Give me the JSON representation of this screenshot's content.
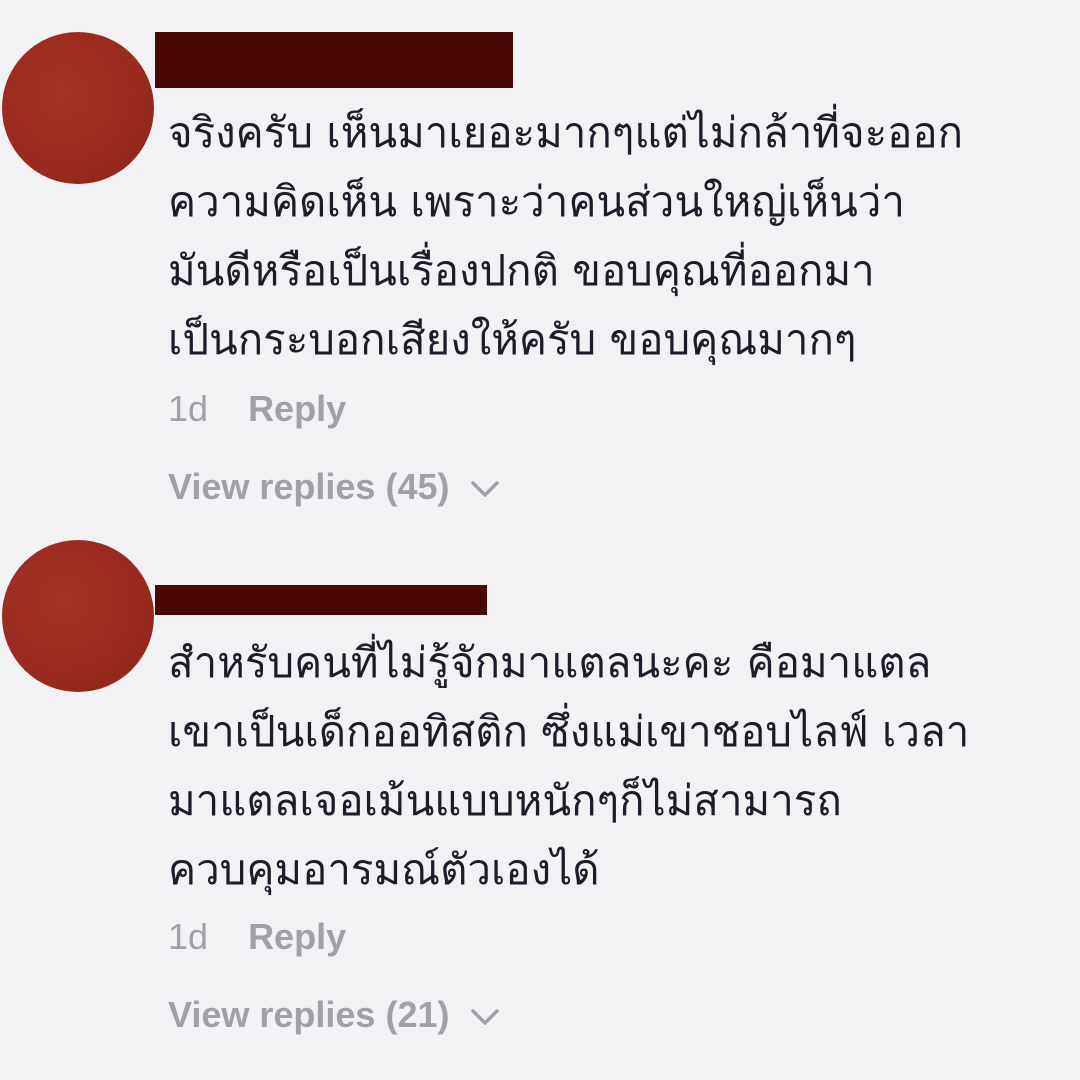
{
  "comments": [
    {
      "lines": [
        "จริงครับ เห็นมาเยอะมากๆแต่ไม่กล้าที่จะออก",
        "ความคิดเห็น เพราะว่าคนส่วนใหญ่เห็นว่า",
        "มันดีหรือเป็นเรื่องปกติ ขอบคุณที่ออกมา",
        "เป็นกระบอกเสียงให้ครับ ขอบคุณมากๆ"
      ],
      "time": "1d",
      "reply_label": "Reply",
      "view_replies_label": "View replies (45)",
      "avatar_color": "#9a2b20",
      "name_redaction_color": "#4a0906"
    },
    {
      "lines": [
        "สำหรับคนที่ไม่รู้จักมาแตลนะคะ คือมาแตล",
        "เขาเป็นเด็กออทิสติก ซึ่งแม่เขาชอบไลฟ์ เวลา",
        "มาแตลเจอเม้นแบบหนักๆก็ไม่สามารถ",
        "ควบคุมอารมณ์ตัวเองได้"
      ],
      "time": "1d",
      "reply_label": "Reply",
      "view_replies_label": "View replies (21)",
      "avatar_color": "#9a2b20",
      "name_redaction_color": "#4a0906"
    }
  ],
  "theme": {
    "background": "#f2f1f4",
    "text": "#1f1c2a",
    "muted": "#a19fa8"
  },
  "icons": {
    "expand": "chevron-down-icon"
  }
}
